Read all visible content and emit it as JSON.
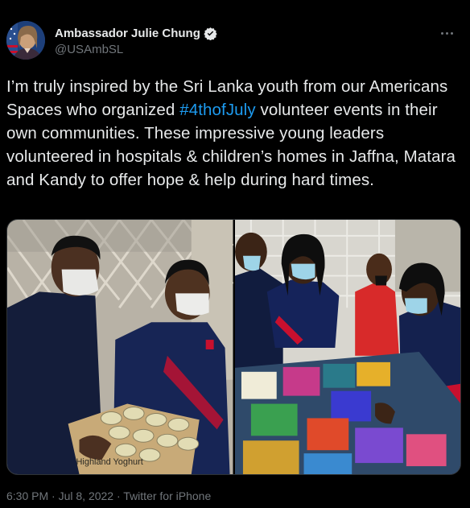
{
  "author": {
    "name": "Ambassador Julie Chung",
    "handle": "@USAmbSL",
    "verified_color": "#1d9bf0"
  },
  "more_icon": "more-horizontal-icon",
  "tweet": {
    "text_before": "I’m truly inspired by the Sri Lanka youth from our Americans Spaces who organized ",
    "hashtag": "#4thofJuly",
    "text_after": " volunteer events in their own communities. These impressive young leaders volunteered in hospitals & children’s homes in Jaffna, Matara and Kandy to offer hope & help during hard times."
  },
  "photos": [
    {
      "name": "volunteers-with-yogurt-photo",
      "printed_text": "Highland Yoghurt"
    },
    {
      "name": "volunteers-with-paintings-photo"
    }
  ],
  "meta": {
    "time": "6:30 PM",
    "separator1": " · ",
    "date": "Jul 8, 2022",
    "separator2": " · ",
    "source": "Twitter for iPhone"
  },
  "colors": {
    "background": "#000000",
    "text": "#e7e9ea",
    "secondary": "#71767b",
    "link": "#1d9bf0"
  }
}
